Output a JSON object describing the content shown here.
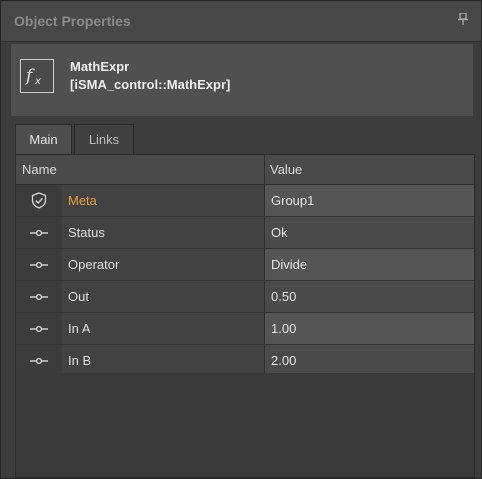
{
  "panel": {
    "title": "Object Properties",
    "pin_icon": "pin-icon"
  },
  "object": {
    "icon": "fx-icon",
    "name": "MathExpr",
    "type": "[iSMA_control::MathExpr]"
  },
  "tabs": [
    {
      "label": "Main",
      "active": true
    },
    {
      "label": "Links",
      "active": false
    }
  ],
  "table": {
    "columns": [
      "Name",
      "Value"
    ],
    "rows": [
      {
        "icon": "shield-check-icon",
        "name": "Meta",
        "value": "Group1",
        "highlight": true
      },
      {
        "icon": "slot-icon",
        "name": "Status",
        "value": "Ok"
      },
      {
        "icon": "slot-icon",
        "name": "Operator",
        "value": "Divide"
      },
      {
        "icon": "slot-icon",
        "name": "Out",
        "value": "0.50"
      },
      {
        "icon": "slot-icon",
        "name": "In A",
        "value": "1.00"
      },
      {
        "icon": "slot-icon",
        "name": "In B",
        "value": "2.00"
      }
    ]
  },
  "colors": {
    "meta_accent": "#e5a33a",
    "background": "#3c3c3c"
  }
}
